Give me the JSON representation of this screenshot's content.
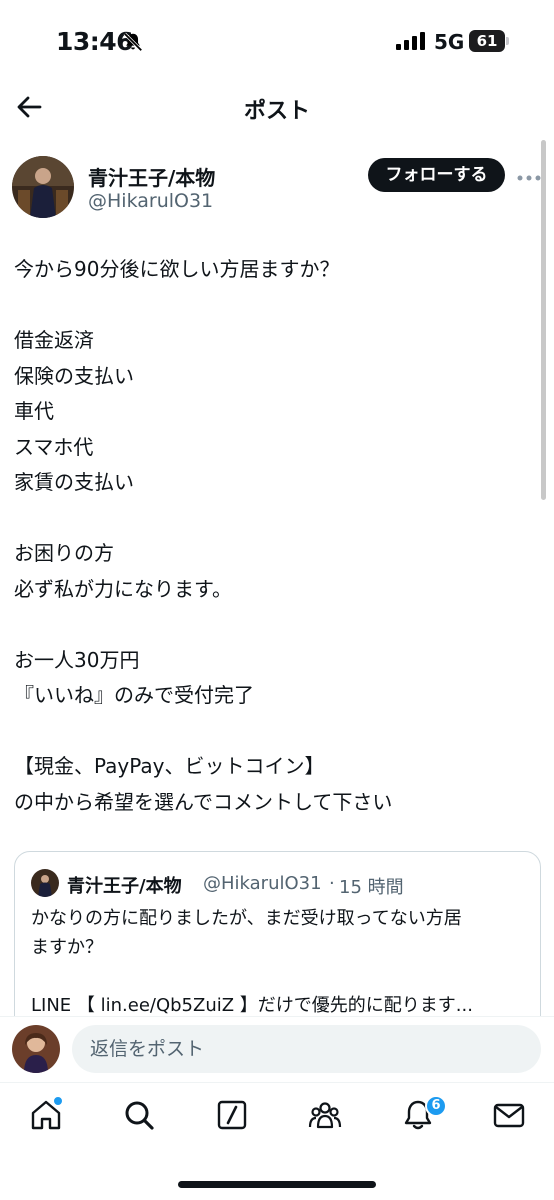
{
  "status_bar": {
    "time": "13:46",
    "network": "5G",
    "battery": "61"
  },
  "header": {
    "title": "ポスト"
  },
  "post": {
    "author_name": "青汁王子/本物",
    "author_handle": "@HikarulO31",
    "follow_label": "フォローする",
    "lines": [
      "今から90分後に欲しい方居ますか？",
      "",
      "借金返済",
      "保険の支払い",
      "車代",
      "スマホ代",
      "家賃の支払い",
      "",
      "お困りの方",
      "必ず私が力になります。",
      "",
      "お一人30万円",
      "『いいね』のみで受付完了",
      "",
      "【現金、PayPay、ビットコイン】",
      "の中から希望を選んでコメントして下さい"
    ]
  },
  "quote": {
    "author_name": "青汁王子/本物",
    "author_handle": "@HikarulO31",
    "separator": "·",
    "time": "15 時間",
    "lines": [
      "かなりの方に配りましたが、まだ受け取ってない方居",
      "ますか？",
      "",
      "LINE 【 lin.ee/Qb5ZuiZ 】だけで優先的に配ります..."
    ]
  },
  "reply": {
    "placeholder": "返信をポスト"
  },
  "tab_bar": {
    "notification_count": "6",
    "tabs": [
      "home-icon",
      "search-icon",
      "grok-icon",
      "communities-icon",
      "notifications-icon",
      "messages-icon"
    ]
  },
  "colors": {
    "accent": "#1d9bf0",
    "text": "#0f1419",
    "secondary_text": "#536471",
    "follow_button": "#0f1419"
  }
}
